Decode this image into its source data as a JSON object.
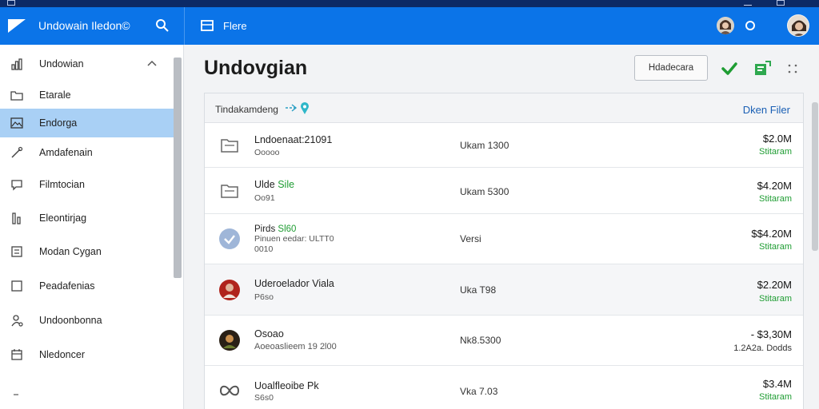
{
  "app": {
    "title": "Undowain Iledon©",
    "browse_label": "Flere"
  },
  "sidebar": {
    "items": [
      {
        "label": "Undowian",
        "icon": "bar-chart-icon"
      },
      {
        "label": "Etarale",
        "icon": "folder-icon"
      },
      {
        "label": "Endorga",
        "icon": "image-icon"
      },
      {
        "label": "Amdafenain",
        "icon": "pen-icon"
      },
      {
        "label": "Filmtocian",
        "icon": "chat-icon"
      },
      {
        "label": "Eleontirjag",
        "icon": "chart-bars-icon"
      },
      {
        "label": "Modan Cygan",
        "icon": "document-icon"
      },
      {
        "label": "Peadafenias",
        "icon": "square-icon"
      },
      {
        "label": "Undoonbonna",
        "icon": "user-settings-icon"
      },
      {
        "label": "Nledoncer",
        "icon": "calendar-icon"
      }
    ]
  },
  "main": {
    "title": "Undovgian",
    "header_button": "Hdadecara",
    "card": {
      "breadcrumb": "Tindakamdeng",
      "filter_label": "Dken Filer",
      "rows": [
        {
          "name": "Lndoenaat:21091",
          "sub": "Ooooo",
          "mid": "Ukam 1300",
          "amount": "$2.0M",
          "status": "Stitaram",
          "status_color": "#1f9d33",
          "icon": "folder-icon"
        },
        {
          "name": "Ulde",
          "name_highlight": "Sile",
          "sub": "Oo91",
          "mid": "Ukam 5300",
          "amount": "$4.20M",
          "status": "Stitaram",
          "status_color": "#1f9d33",
          "icon": "folder-icon"
        },
        {
          "name": "Pirds",
          "name_highlight": "Sl60",
          "sub": "Pinuen eedar: ULTT0",
          "sub2": "0010",
          "mid": "Versi",
          "amount": "$$4.20M",
          "status": "Stitaram",
          "status_color": "#1f9d33",
          "icon": "avatar-icon"
        },
        {
          "name": "Uderoelador Viala",
          "sub": "P6so",
          "mid": "Uka T98",
          "amount": "$2.20M",
          "status": "Stitaram",
          "status_color": "#1f9d33",
          "icon": "avatar-icon"
        },
        {
          "name": "Osoao",
          "sub": "Aoeoaslieem 19 2l00",
          "mid": "Nk8.5300",
          "amount": "- $3,30M",
          "status": "1.2A2a. Dodds",
          "status_color": "#333333",
          "icon": "avatar-icon"
        },
        {
          "name": "Uoalfleoibe Pk",
          "sub": "S6s0",
          "mid": "Vka 7.03",
          "amount": "$3.4M",
          "status": "Stitaram",
          "status_color": "#1f9d33",
          "icon": "infinity-icon"
        }
      ]
    }
  },
  "colors": {
    "accent": "#0b74e8",
    "sidebar_active": "#a9d0f5",
    "positive": "#1f9d33"
  }
}
